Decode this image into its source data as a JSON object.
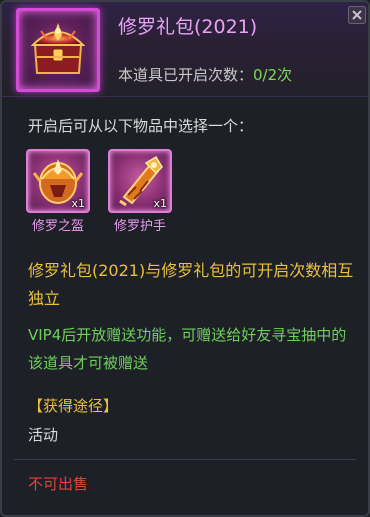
{
  "item": {
    "name": "修罗礼包(2021)",
    "open_count_label": "本道具已开启次数：",
    "open_count_value": "0/2次",
    "icon": "treasure-chest-icon",
    "rarity_color": "#d54bd9"
  },
  "intro_text": "开启后可从以下物品中选择一个：",
  "rewards": [
    {
      "name": "修罗之盔",
      "qty": "x1",
      "icon": "helmet-icon"
    },
    {
      "name": "修罗护手",
      "qty": "x1",
      "icon": "gauntlet-icon"
    }
  ],
  "notice_text": "修罗礼包(2021)与修罗礼包的可开启次数相互独立",
  "vip_text": "VIP4后开放赠送功能，可赠送给好友寻宝抽中的该道具才可被赠送",
  "source": {
    "label": "【获得途径】",
    "value": "活动"
  },
  "sell_status": "不可出售",
  "colors": {
    "title": "#e8a4f2",
    "gold": "#e9c13d",
    "green": "#6fcf5a",
    "red": "#e0453d"
  }
}
